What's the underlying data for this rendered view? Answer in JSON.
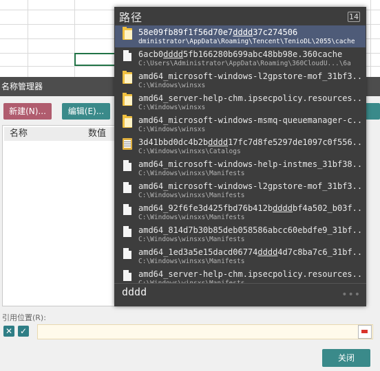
{
  "dialog": {
    "title": "名称管理器",
    "new_button": "新建(N)...",
    "edit_button": "编辑(E)...",
    "list_headers": {
      "name": "名称",
      "value": "数值"
    },
    "ref_label": "引用位置(R):",
    "ref_cancel_glyph": "✕",
    "ref_confirm_glyph": "✓",
    "ref_value": "",
    "close_button": "关闭"
  },
  "popup": {
    "title": "路径",
    "count": "14",
    "query": "dddd",
    "more_glyph": "•••",
    "results": [
      {
        "icon": "folder-icon",
        "name_pre": "58e09fb89f1f56d70e7",
        "name_hl": "dddd",
        "name_post": "37c274506",
        "path": "dministrator\\AppData\\Roaming\\Tencent\\TenioDL\\2055\\cache",
        "selected": true
      },
      {
        "icon": "file-icon",
        "name_pre": "6acb0",
        "name_hl": "dddd",
        "name_post": "5fb166280b699abc48bb98e.360cache",
        "path": "C:\\Users\\Administrator\\AppData\\Roaming\\360CloudU...\\6a",
        "selected": false
      },
      {
        "icon": "folder-icon",
        "name_pre": "amd64_microsoft-windows-l2gpstore-mof_31bf3...",
        "name_hl": "",
        "name_post": "",
        "path": "C:\\Windows\\winsxs",
        "selected": false
      },
      {
        "icon": "folder-icon",
        "name_pre": "amd64_server-help-chm.ipsecpolicy.resources...",
        "name_hl": "",
        "name_post": "",
        "path": "C:\\Windows\\winsxs",
        "selected": false
      },
      {
        "icon": "folder-icon",
        "name_pre": "amd64_microsoft-windows-msmq-queuemanager-c...",
        "name_hl": "",
        "name_post": "",
        "path": "C:\\Windows\\winsxs",
        "selected": false
      },
      {
        "icon": "catalog-icon",
        "name_pre": "3d41bbd0dc4b2b",
        "name_hl": "dddd",
        "name_post": "17fc7d8fe5297de1097c0f556...",
        "path": "C:\\Windows\\winsxs\\Catalogs",
        "selected": false
      },
      {
        "icon": "file-icon",
        "name_pre": "amd64_microsoft-windows-help-instmes_31bf38...",
        "name_hl": "",
        "name_post": "",
        "path": "C:\\Windows\\winsxs\\Manifests",
        "selected": false
      },
      {
        "icon": "file-icon",
        "name_pre": "amd64_microsoft-windows-l2gpstore-mof_31bf3...",
        "name_hl": "",
        "name_post": "",
        "path": "C:\\Windows\\winsxs\\Manifests",
        "selected": false
      },
      {
        "icon": "file-icon",
        "name_pre": "amd64_92f6fe3d425fbd76b412b",
        "name_hl": "dddd",
        "name_post": "bf4a502_b03f...",
        "path": "C:\\Windows\\winsxs\\Manifests",
        "selected": false
      },
      {
        "icon": "file-icon",
        "name_pre": "amd64_814d7b30b85deb058586abcc60ebdfe9_31bf...",
        "name_hl": "",
        "name_post": "",
        "path": "C:\\Windows\\winsxs\\Manifests",
        "selected": false
      },
      {
        "icon": "file-icon",
        "name_pre": "amd64_1ed3a5e15dacd06774",
        "name_hl": "dddd",
        "name_post": "4d7c8ba7c6_31bf...",
        "path": "C:\\Windows\\winsxs\\Manifests",
        "selected": false
      },
      {
        "icon": "file-icon",
        "name_pre": "amd64_server-help-chm.ipsecpolicy.resources...",
        "name_hl": "",
        "name_post": "",
        "path": "C:\\Windows\\winsxs\\Manifests",
        "selected": false
      }
    ]
  }
}
